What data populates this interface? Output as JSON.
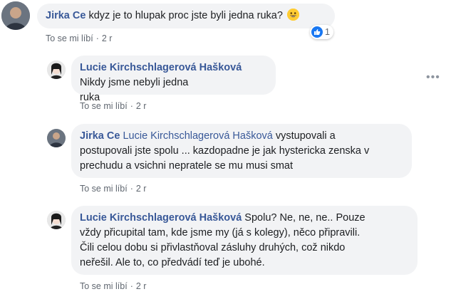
{
  "colors": {
    "link": "#385898",
    "bubble": "#f2f3f5",
    "meta": "#606770",
    "like_blue": "#1877f2"
  },
  "comments": [
    {
      "author": "Jirka Ce",
      "text": " kdyz je to hlupak proc jste byli jedna ruka?",
      "emoji": "grinning-face",
      "like_label": "To se mi líbí",
      "time": "2 r",
      "reaction_count": "1"
    },
    {
      "author": "Lucie Kirchschlagerová Hašková",
      "text_line1": " Nikdy jsme nebyli jedna",
      "text_line2": "ruka",
      "like_label": "To se mi líbí",
      "time": "2 r"
    },
    {
      "author": "Jirka Ce",
      "mention": " Lucie Kirchschlagerová Hašková",
      "text_line1": " vystupovali a",
      "text_line2": "postupovali jste spolu ... kazdopadne je jak hystericka zenska v",
      "text_line3": "prechudu a vsichni nepratele se mu musi smat",
      "like_label": "To se mi líbí",
      "time": "2 r"
    },
    {
      "author": "Lucie Kirchschlagerová Hašková",
      "text_line1": " Spolu? Ne, ne, ne.. Pouze",
      "text_line2": "vždy přicupital tam, kde jsme my (já s kolegy), něco připravili.",
      "text_line3": "Čili celou dobu si přivlastňoval zásluhy druhých, což nikdo",
      "text_line4": "neřešil. Ale to, co předvádí teď je ubohé.",
      "like_label": "To se mi líbí",
      "time": "2 r"
    }
  ],
  "separator": "·"
}
